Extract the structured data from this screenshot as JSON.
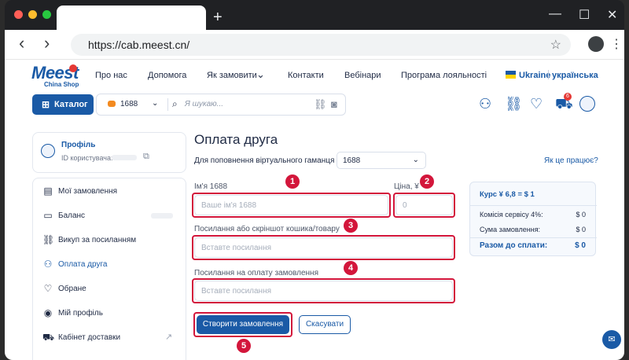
{
  "browser": {
    "url": "https://cab.meest.cn/",
    "new_tab": "+",
    "controls": {
      "minimize": "—",
      "maximize": "☐",
      "close": "✕"
    },
    "back": "‹",
    "forward": "›",
    "star": "☆",
    "menu": "⋮"
  },
  "header": {
    "logo_main": "Meest",
    "logo_sub": "China Shop",
    "menu": [
      "Про нас",
      "Допомога",
      "Як замовити",
      "Контакти",
      "Вебінари",
      "Програма лояльності"
    ],
    "menu_chevron": "⌄",
    "lang_country": "Ukraine",
    "lang_name": "українська",
    "catalog_label": "Каталог",
    "search_source": "1688",
    "search_placeholder": "Я шукаю...",
    "cart_count": "6",
    "colors": {
      "brand": "#1a5aa6",
      "accent": "#e53935",
      "highlight": "#d3163b"
    }
  },
  "sidebar": {
    "profile_title": "Профіль",
    "profile_id_label": "ID користувача:",
    "items": [
      {
        "label": "Мої замовлення",
        "icon": "orders-icon"
      },
      {
        "label": "Баланс",
        "icon": "wallet-icon"
      },
      {
        "label": "Викуп за посиланням",
        "icon": "link-icon"
      },
      {
        "label": "Оплата друга",
        "icon": "users-icon"
      },
      {
        "label": "Обране",
        "icon": "heart-icon"
      },
      {
        "label": "Мій профіль",
        "icon": "user-icon"
      },
      {
        "label": "Кабінет доставки",
        "icon": "truck-icon"
      }
    ]
  },
  "main": {
    "title": "Оплата друга",
    "wallet_label": "Для поповнення віртуального гаманця",
    "wallet_value": "1688",
    "how_link": "Як це працює?",
    "name_label": "Ім'я 1688",
    "name_placeholder": "Ваше ім'я 1688",
    "price_label": "Ціна, ¥",
    "price_placeholder": "0",
    "link_label": "Посилання або скріншот кошика/товару",
    "link_placeholder": "Вставте посилання",
    "pay_label": "Посилання на оплату замовлення",
    "pay_placeholder": "Вставте посилання",
    "create_btn": "Створити замовлення",
    "cancel_btn": "Скасувати",
    "markers": [
      "1",
      "2",
      "3",
      "4",
      "5"
    ]
  },
  "summary": {
    "rate": "Курс ¥ 6,8 = $ 1",
    "fee_label": "Комісія сервісу 4%:",
    "fee_value": "$ 0",
    "order_label": "Сума замовлення:",
    "order_value": "$ 0",
    "total_label": "Разом до сплати:",
    "total_value": "$ 0"
  }
}
